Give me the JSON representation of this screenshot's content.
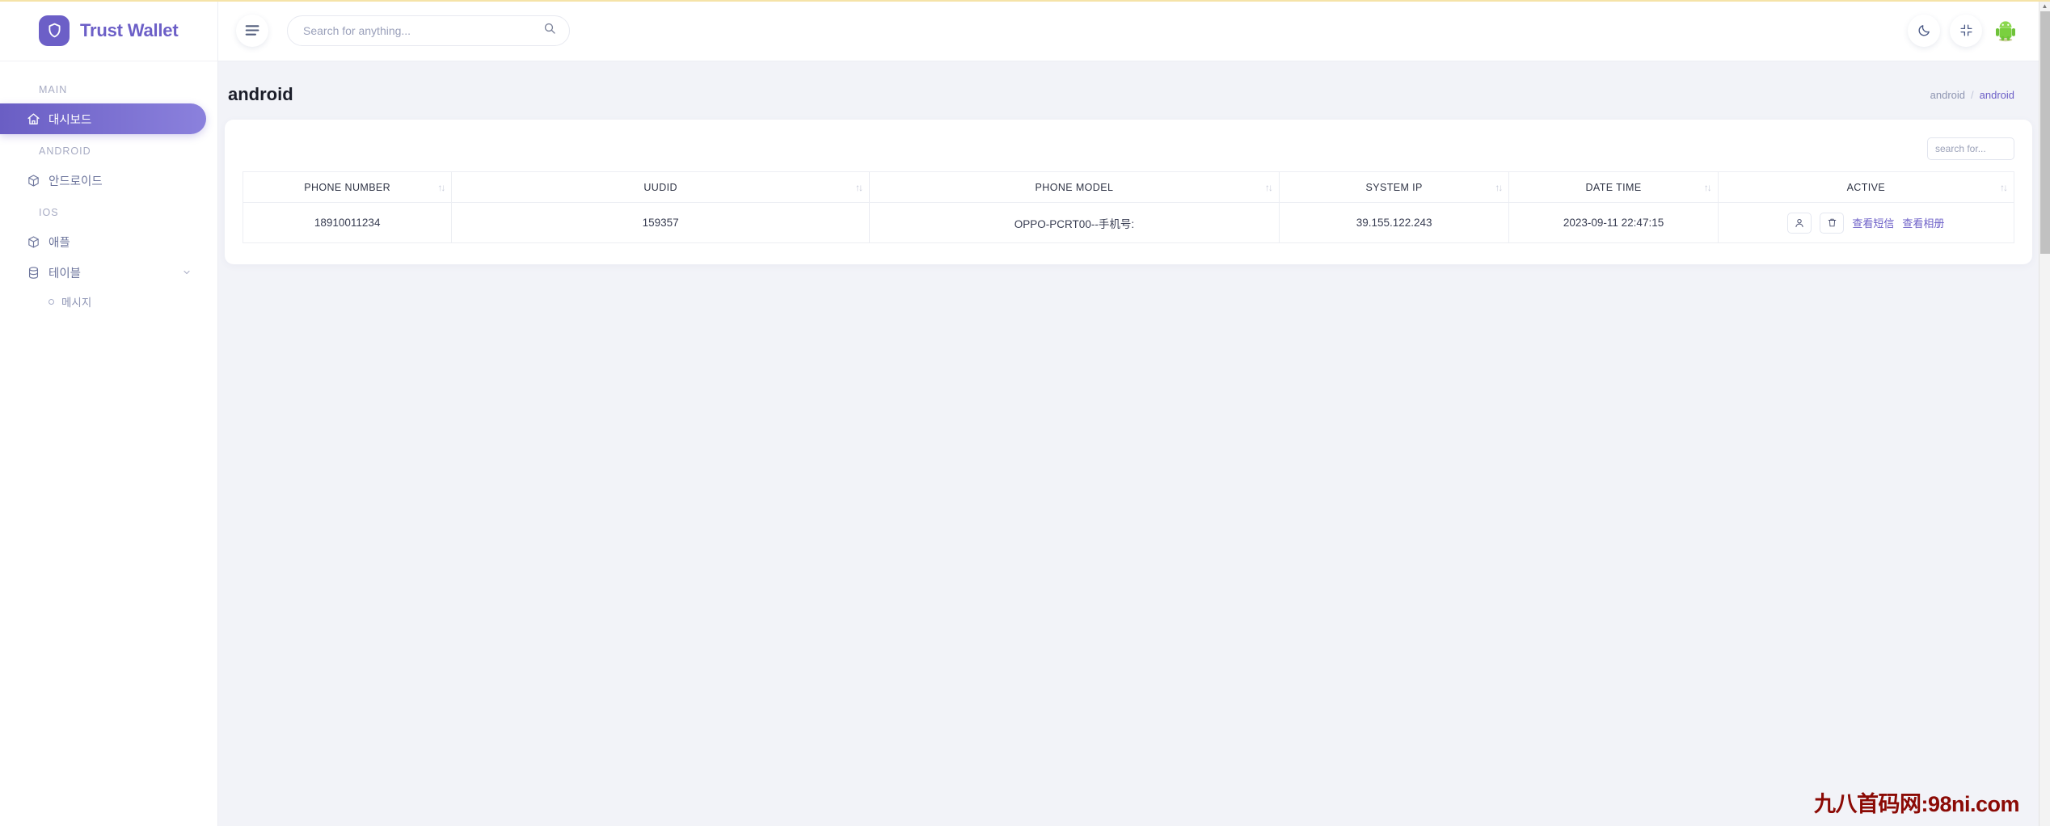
{
  "brand": {
    "name": "Trust Wallet",
    "logo_icon": "shield-icon",
    "accent": "#6c5fc7"
  },
  "sidebar": {
    "sections": [
      {
        "label": "MAIN",
        "items": [
          {
            "label": "대시보드",
            "icon": "home-icon",
            "active": true
          }
        ]
      },
      {
        "label": "ANDROID",
        "items": [
          {
            "label": "안드로이드",
            "icon": "box-icon",
            "active": false
          }
        ]
      },
      {
        "label": "IOS",
        "items": [
          {
            "label": "애플",
            "icon": "box-icon",
            "active": false
          },
          {
            "label": "테이블",
            "icon": "database-icon",
            "active": false,
            "expandable": true
          }
        ]
      }
    ],
    "sub_items": [
      {
        "label": "메시지",
        "icon": "bullet-icon"
      }
    ]
  },
  "topbar": {
    "menu_icon": "hamburger-icon",
    "search": {
      "placeholder": "Search for anything...",
      "value": "",
      "icon": "search-icon"
    },
    "dark_mode_icon": "moon-icon",
    "fullscreen_icon": "collapse-icon",
    "avatar_icon": "android-robot-avatar"
  },
  "page": {
    "title": "android",
    "breadcrumb": {
      "parent": "android",
      "separator": "/",
      "current": "android"
    }
  },
  "table": {
    "search": {
      "placeholder": "search for...",
      "value": ""
    },
    "columns": [
      {
        "label": "PHONE NUMBER",
        "sortable": true
      },
      {
        "label": "UUDID",
        "sortable": true
      },
      {
        "label": "PHONE MODEL",
        "sortable": true
      },
      {
        "label": "SYSTEM IP",
        "sortable": true
      },
      {
        "label": "DATE TIME",
        "sortable": true
      },
      {
        "label": "ACTIVE",
        "sortable": true
      }
    ],
    "sort_icon": "sort-updown-icon",
    "rows": [
      {
        "phone_number": "18910011234",
        "uudid": "159357",
        "phone_model": "OPPO-PCRT00--手机号:",
        "system_ip": "39.155.122.243",
        "date_time": "2023-09-11 22:47:15",
        "actions": {
          "user_icon": "user-icon",
          "delete_icon": "trash-icon",
          "link_sms": "查看短信",
          "link_album": "查看相册"
        }
      }
    ]
  },
  "watermark": {
    "text": "九八首码网:98ni.com",
    "color": "#8b0a05"
  }
}
